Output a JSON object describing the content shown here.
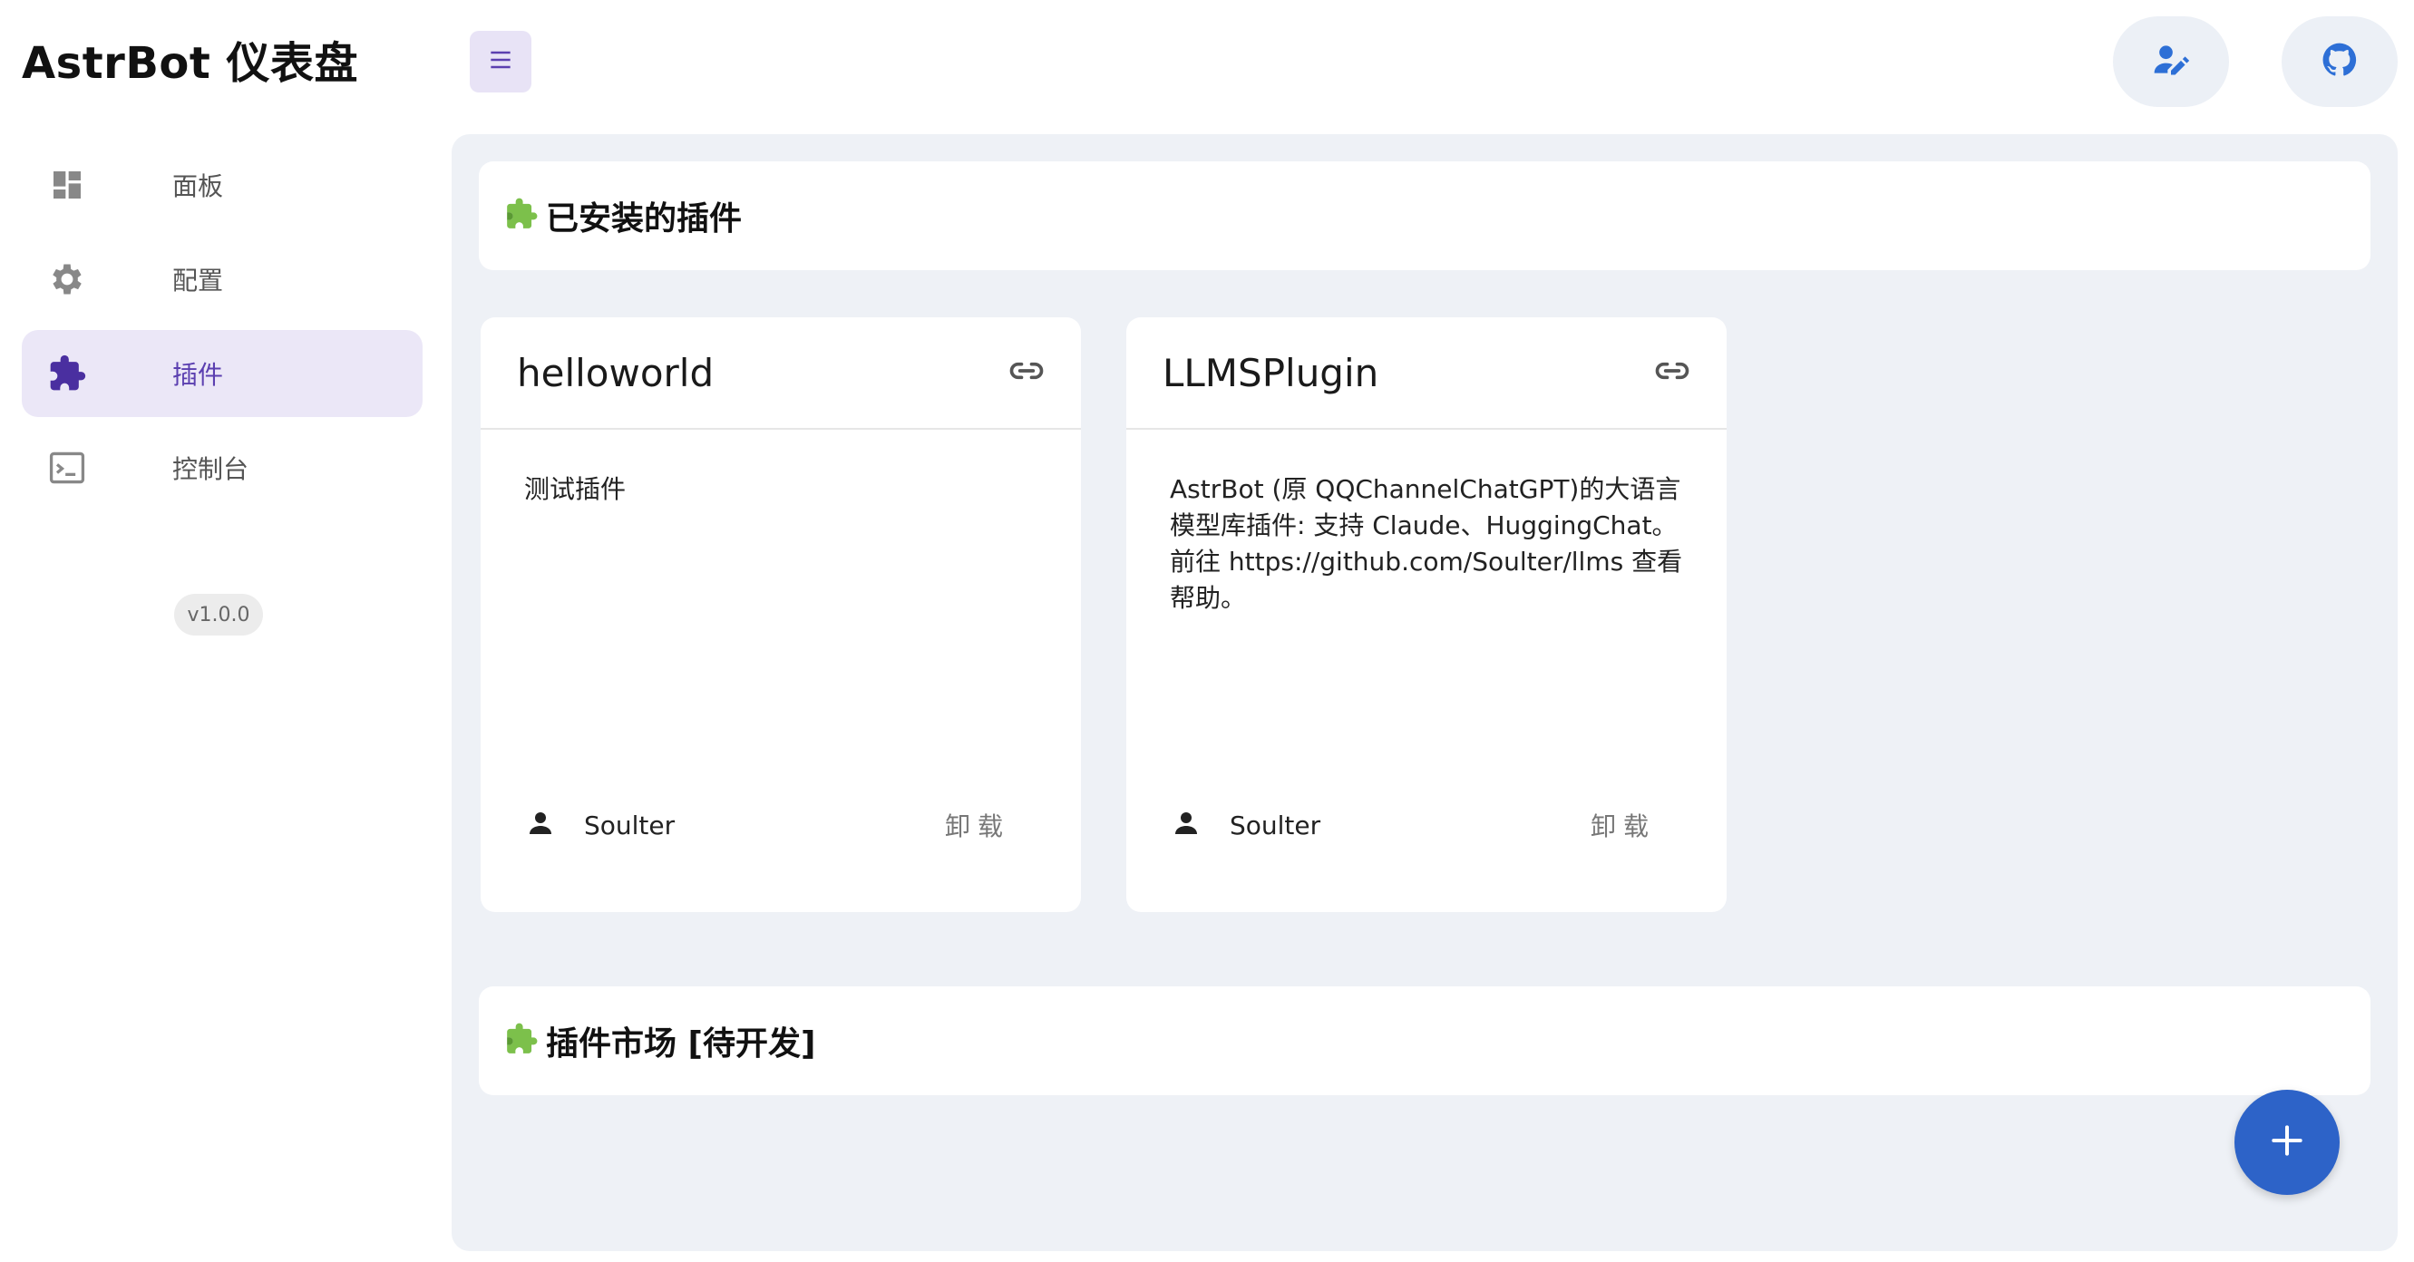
{
  "brand": {
    "title": "AstrBot 仪表盘"
  },
  "sidebar": {
    "items": [
      {
        "label": "面板",
        "icon": "dashboard-icon",
        "active": false
      },
      {
        "label": "配置",
        "icon": "gear-icon",
        "active": false
      },
      {
        "label": "插件",
        "icon": "puzzle-icon",
        "active": true
      },
      {
        "label": "控制台",
        "icon": "console-icon",
        "active": false
      }
    ],
    "version": "v1.0.0"
  },
  "topbar": {
    "menu_icon": "hamburger-menu-icon",
    "edit_icon": "user-edit-icon",
    "github_icon": "github-icon"
  },
  "sections": {
    "installed_title": "已安装的插件",
    "market_title": "插件市场 [待开发]"
  },
  "plugins": [
    {
      "name": "helloworld",
      "description": "测试插件",
      "author": "Soulter",
      "uninstall_label": "卸载"
    },
    {
      "name": "LLMSPlugin",
      "description": "AstrBot (原 QQChannelChatGPT)的大语言模型库插件: 支持 Claude、HuggingChat。前往 https://github.com/Soulter/llms 查看帮助。",
      "author": "Soulter",
      "uninstall_label": "卸载"
    }
  ],
  "fab": {
    "icon": "plus-icon"
  },
  "colors": {
    "accent": "#5b3fb0",
    "active_bg": "#ebe7f7",
    "main_bg": "#eef1f6",
    "fab": "#2d63c8",
    "github_icon": "#2d6fd6"
  }
}
